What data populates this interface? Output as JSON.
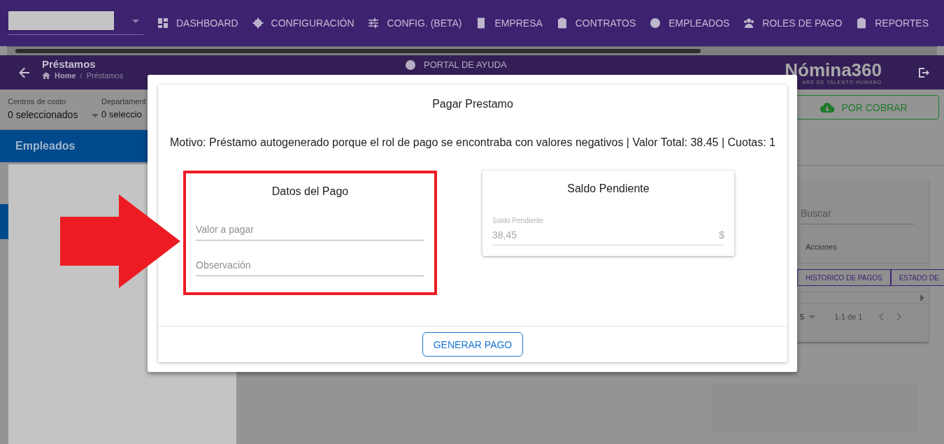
{
  "top_nav": {
    "items": [
      "DASHBOARD",
      "CONFIGURACIÓN",
      "CONFIG. (BETA)",
      "EMPRESA",
      "CONTRATOS",
      "EMPLEADOS",
      "ROLES DE PAGO",
      "REPORTES"
    ]
  },
  "header": {
    "title": "Préstamos",
    "breadcrumb": [
      "Home",
      "Préstamos"
    ],
    "breadcrumb_separator": "/",
    "help_link": "PORTAL DE AYUDA",
    "logo": "Nómina360",
    "logo_tagline": "ARE DE TALENTO HUMANO"
  },
  "filters": [
    {
      "label": "Centros de costo",
      "value": "0 seleccionados"
    },
    {
      "label": "Departament",
      "value": "0 seleccio"
    }
  ],
  "employees_panel": {
    "title": "Empleados"
  },
  "collect_button": "POR COBRAR",
  "table_card": {
    "search_placeholder": "Buscar",
    "column": "Acciones",
    "row_buttons": [
      "HISTORICO DE PAGOS",
      "ESTADO DE"
    ],
    "rows_per_page": "5",
    "page_range": "1-1 de 1"
  },
  "dialog": {
    "title": "Pagar Prestamo",
    "reason": "Motivo: Préstamo autogenerado porque el rol de pago se encontraba con valores negativos | Valor Total: 38.45 | Cuotas: 1",
    "payment_card": {
      "title": "Datos del Pago",
      "fields": [
        {
          "placeholder": "Valor a pagar"
        },
        {
          "placeholder": "Observación"
        }
      ]
    },
    "balance_card": {
      "title": "Saldo Pendiente",
      "field": {
        "label": "Saldo Pendiente",
        "value": "38,45",
        "suffix": "$"
      }
    },
    "submit_button": "GENERAR PAGO"
  }
}
